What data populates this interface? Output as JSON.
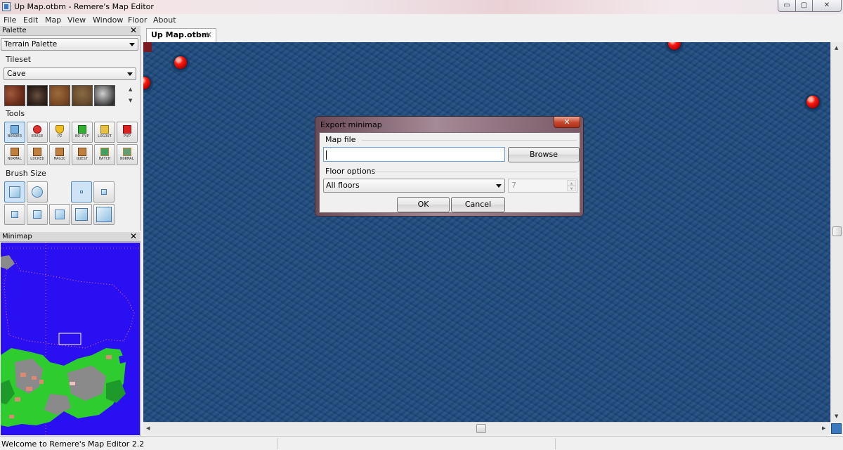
{
  "window": {
    "title": "Up Map.otbm - Remere's Map Editor",
    "min_glyph": "▭",
    "max_glyph": "▢",
    "close_glyph": "✕"
  },
  "menu": [
    "File",
    "Edit",
    "Map",
    "View",
    "Window",
    "Floor",
    "About"
  ],
  "palette": {
    "header": "Palette",
    "close_glyph": "✕",
    "palette_type": "Terrain Palette",
    "tileset_label": "Tileset",
    "tileset_value": "Cave",
    "tools_label": "Tools",
    "tools_row1": [
      "BORDER",
      "ERASE",
      "PZ",
      "NO-PVP",
      "LOGOUT",
      "PVP"
    ],
    "tools_row2": [
      "NORMAL",
      "LOCKED",
      "MAGIC",
      "QUEST",
      "HATCH",
      "NORMAL"
    ],
    "brush_size_label": "Brush Size",
    "scroll_up": "▲",
    "scroll_down": "▼"
  },
  "minimap": {
    "header": "Minimap",
    "close_glyph": "✕"
  },
  "document": {
    "tab_label": "Up Map.otbm",
    "tab_close_glyph": "✕"
  },
  "scroll": {
    "up": "▲",
    "down": "▼",
    "left": "◀",
    "right": "▶"
  },
  "status": {
    "text": "Welcome to Remere's Map Editor 2.2"
  },
  "dialog": {
    "title": "Export minimap",
    "close_glyph": "✕",
    "map_file_label": "Map file",
    "map_file_value": "",
    "browse_label": "Browse",
    "floor_options_label": "Floor options",
    "floor_select_value": "All floors",
    "floor_spin_value": "7",
    "ok_label": "OK",
    "cancel_label": "Cancel"
  },
  "colors": {
    "water": "#1d4a7c",
    "minimap_water": "#2a0ff2",
    "grass": "#2ecc2e",
    "stone": "#8a8a8a",
    "orb": "#ff1a10"
  },
  "icons": {
    "app": "map-editor-icon",
    "orb": "red-orb-item"
  }
}
